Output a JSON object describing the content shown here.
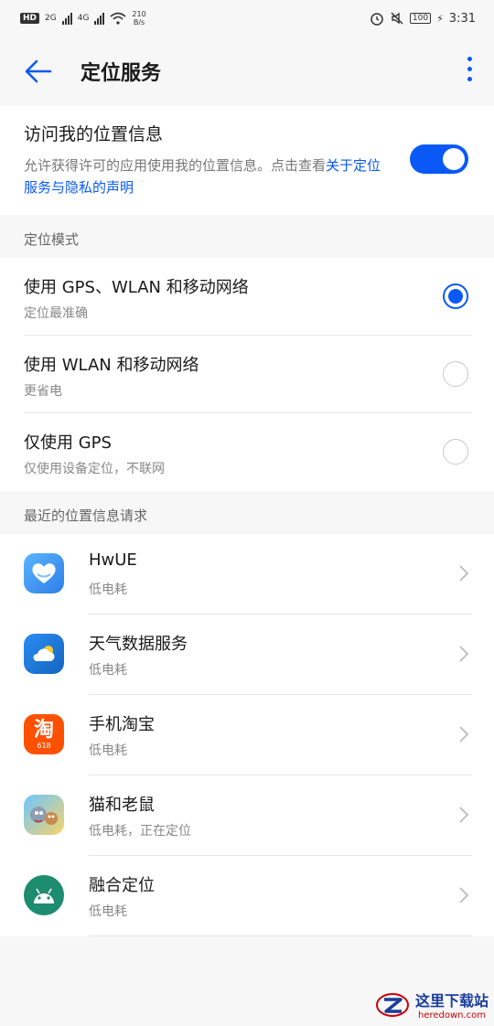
{
  "status_bar": {
    "hd": "HD",
    "sig1": "2G",
    "sig2": "4G",
    "speed_value": "210",
    "speed_unit": "B/s",
    "battery": "100",
    "time": "3:31"
  },
  "app_bar": {
    "title": "定位服务"
  },
  "access": {
    "title": "访问我的位置信息",
    "desc": "允许获得许可的应用使用我的位置信息。点击查看",
    "link": "关于定位服务与隐私的声明",
    "enabled": true
  },
  "location_mode": {
    "header": "定位模式",
    "options": [
      {
        "title": "使用 GPS、WLAN 和移动网络",
        "subtitle": "定位最准确",
        "selected": true
      },
      {
        "title": "使用 WLAN 和移动网络",
        "subtitle": "更省电",
        "selected": false
      },
      {
        "title": "仅使用 GPS",
        "subtitle": "仅使用设备定位，不联网",
        "selected": false
      }
    ]
  },
  "recent_requests": {
    "header": "最近的位置信息请求",
    "apps": [
      {
        "name": "HwUE",
        "status": "低电耗",
        "icon": "hwue-icon"
      },
      {
        "name": "天气数据服务",
        "status": "低电耗",
        "icon": "weather-icon"
      },
      {
        "name": "手机淘宝",
        "status": "低电耗",
        "icon": "taobao-icon",
        "icon_char": "淘",
        "icon_sub": "618"
      },
      {
        "name": "猫和老鼠",
        "status": "低电耗，正在定位",
        "icon": "tom-and-jerry-icon"
      },
      {
        "name": "融合定位",
        "status": "低电耗",
        "icon": "android-icon"
      }
    ]
  },
  "watermark": {
    "title": "这里下载站",
    "url": "heredown.com"
  },
  "colors": {
    "accent": "#0a59f7",
    "background": "#f7f7f7"
  }
}
